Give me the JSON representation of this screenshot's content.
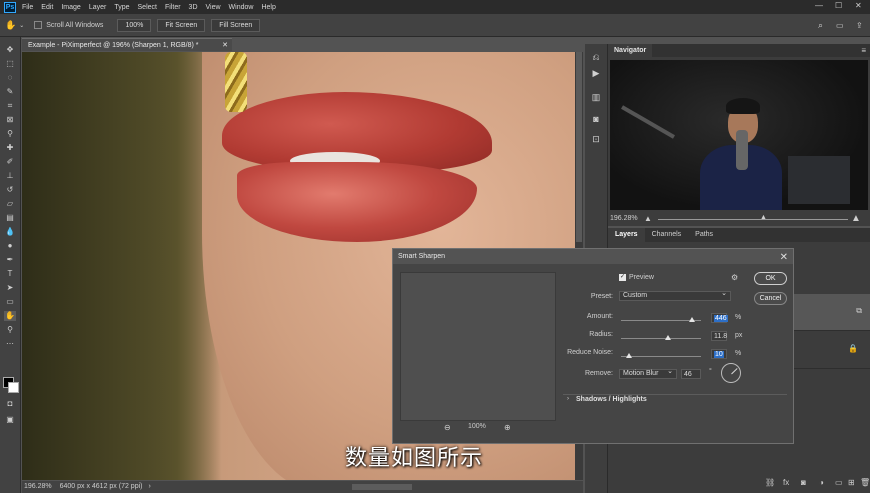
{
  "app": {
    "logo": "Ps"
  },
  "menu": [
    "File",
    "Edit",
    "Image",
    "Layer",
    "Type",
    "Select",
    "Filter",
    "3D",
    "View",
    "Window",
    "Help"
  ],
  "options": {
    "scroll_all": "Scroll All Windows",
    "zoom": "100%",
    "fit": "Fit Screen",
    "fill": "Fill Screen"
  },
  "document": {
    "tab": "Example - PiXimperfect @ 196% (Sharpen 1, RGB/8) *"
  },
  "status": {
    "zoom": "196.28%",
    "size": "6400 px x 4612 px (72 ppi)"
  },
  "navigator": {
    "title": "Navigator",
    "zoom": "196.28%"
  },
  "layers_panel": {
    "tabs": [
      "Layers",
      "Channels",
      "Paths"
    ]
  },
  "dialog": {
    "title": "Smart Sharpen",
    "preview_label": "Preview",
    "ok": "OK",
    "cancel": "Cancel",
    "preset_label": "Preset:",
    "preset_value": "Custom",
    "amount_label": "Amount:",
    "amount_value": "446",
    "amount_unit": "%",
    "amount_fraction": 0.89,
    "radius_label": "Radius:",
    "radius_value": "11.8",
    "radius_unit": "px",
    "radius_fraction": 0.59,
    "noise_label": "Reduce Noise:",
    "noise_value": "10",
    "noise_unit": "%",
    "noise_fraction": 0.1,
    "remove_label": "Remove:",
    "remove_value": "Motion Blur",
    "angle_value": "46",
    "angle_unit": "°",
    "shadows_label": "Shadows / Highlights",
    "zoom_level": "100%"
  },
  "subtitle": "数量如图所示"
}
